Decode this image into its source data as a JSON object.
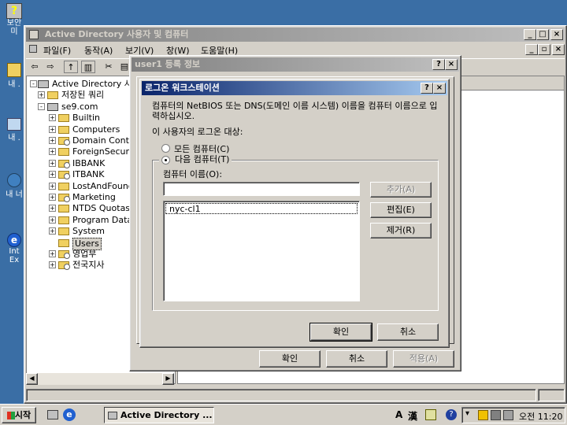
{
  "desktop": {
    "icons": [
      {
        "label": "보안\n미"
      },
      {
        "label": "내 ."
      },
      {
        "label": "내 ."
      },
      {
        "label": "내 너"
      },
      {
        "label": "Int\nEx"
      }
    ]
  },
  "main_window": {
    "title": "Active Directory 사용자 및 컴퓨터",
    "menu": [
      "파일(F)",
      "동작(A)",
      "보기(V)",
      "창(W)",
      "도움말(H)"
    ],
    "tree_root": "Active Directory 사용자",
    "tree": [
      {
        "label": "저장된 쿼리",
        "level": 1,
        "expander": "+",
        "ou": false
      },
      {
        "label": "se9.com",
        "level": 1,
        "expander": "-",
        "ou": false,
        "domain": true
      },
      {
        "label": "Builtin",
        "level": 2,
        "expander": "+",
        "ou": false
      },
      {
        "label": "Computers",
        "level": 2,
        "expander": "+",
        "ou": false
      },
      {
        "label": "Domain Contro",
        "level": 2,
        "expander": "+",
        "ou": true
      },
      {
        "label": "ForeignSecurit",
        "level": 2,
        "expander": "+",
        "ou": false
      },
      {
        "label": "IBBANK",
        "level": 2,
        "expander": "+",
        "ou": true
      },
      {
        "label": "ITBANK",
        "level": 2,
        "expander": "+",
        "ou": true
      },
      {
        "label": "LostAndFound",
        "level": 2,
        "expander": "+",
        "ou": false
      },
      {
        "label": "Marketing",
        "level": 2,
        "expander": "+",
        "ou": true
      },
      {
        "label": "NTDS Quotas",
        "level": 2,
        "expander": "+",
        "ou": false
      },
      {
        "label": "Program Data",
        "level": 2,
        "expander": "+",
        "ou": false
      },
      {
        "label": "System",
        "level": 2,
        "expander": "+",
        "ou": false
      },
      {
        "label": "Users",
        "level": 2,
        "expander": "",
        "ou": false,
        "selected": true
      },
      {
        "label": "영업부",
        "level": 2,
        "expander": "+",
        "ou": true
      },
      {
        "label": "전국지사",
        "level": 2,
        "expander": "+",
        "ou": true
      }
    ]
  },
  "properties_dialog": {
    "title": "user1 등록 정보",
    "help": "?",
    "close": "×",
    "ok": "확인",
    "cancel": "취소",
    "apply": "적용(A)"
  },
  "logon_dialog": {
    "title": "로그온 워크스테이션",
    "help": "?",
    "close": "×",
    "description": "컴퓨터의 NetBIOS 또는 DNS(도메인 이름 시스템) 이름을 컴퓨터 이름으로 입력하십시오.",
    "group_label": "이 사용자의 로그온 대상:",
    "radio_all": "모든 컴퓨터(C)",
    "radio_following": "다음 컴퓨터(T)",
    "computer_name_label": "컴퓨터 이름(O):",
    "computer_name_value": "",
    "list_items": [
      "nyc-cl1"
    ],
    "add": "추가(A)",
    "edit": "편집(E)",
    "remove": "제거(R)",
    "ok": "확인",
    "cancel": "취소"
  },
  "taskbar": {
    "start": "시작",
    "task": "Active Directory ...",
    "ime_a": "A",
    "ime_han": "漢",
    "clock": "오전 11:20"
  }
}
